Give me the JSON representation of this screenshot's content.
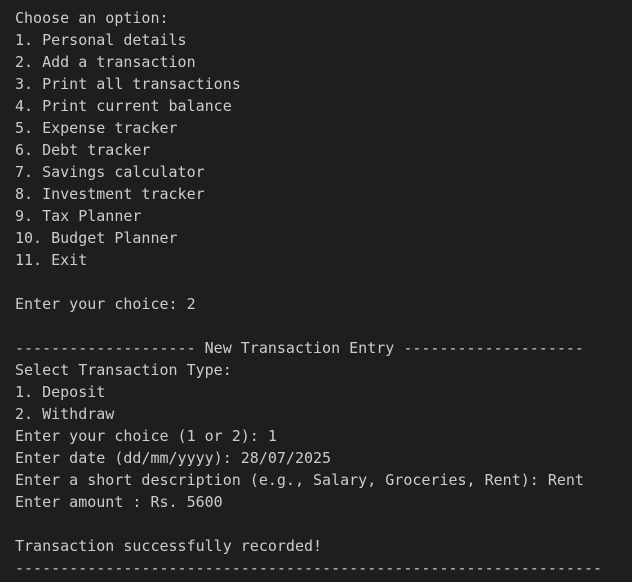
{
  "menu": {
    "prompt": "Choose an option:",
    "options": [
      "1. Personal details",
      "2. Add a transaction",
      "3. Print all transactions",
      "4. Print current balance",
      "5. Expense tracker",
      "6. Debt tracker",
      "7. Savings calculator",
      "8. Investment tracker",
      "9. Tax Planner",
      "10. Budget Planner",
      "11. Exit"
    ],
    "choice_line": "Enter your choice: 2"
  },
  "transaction": {
    "header": "-------------------- New Transaction Entry --------------------",
    "type_prompt": "Select Transaction Type:",
    "type_options": [
      "1. Deposit",
      "2. Withdraw"
    ],
    "type_choice": "Enter your choice (1 or 2): 1",
    "date_line": "Enter date (dd/mm/yyyy): 28/07/2025",
    "description_line": "Enter a short description (e.g., Salary, Groceries, Rent): Rent",
    "amount_line": "Enter amount : Rs. 5600",
    "success_message": "Transaction successfully recorded!",
    "footer_rule": "-----------------------------------------------------------------"
  },
  "colors": {
    "background": "#1e1e1e",
    "text": "#cccccc"
  }
}
